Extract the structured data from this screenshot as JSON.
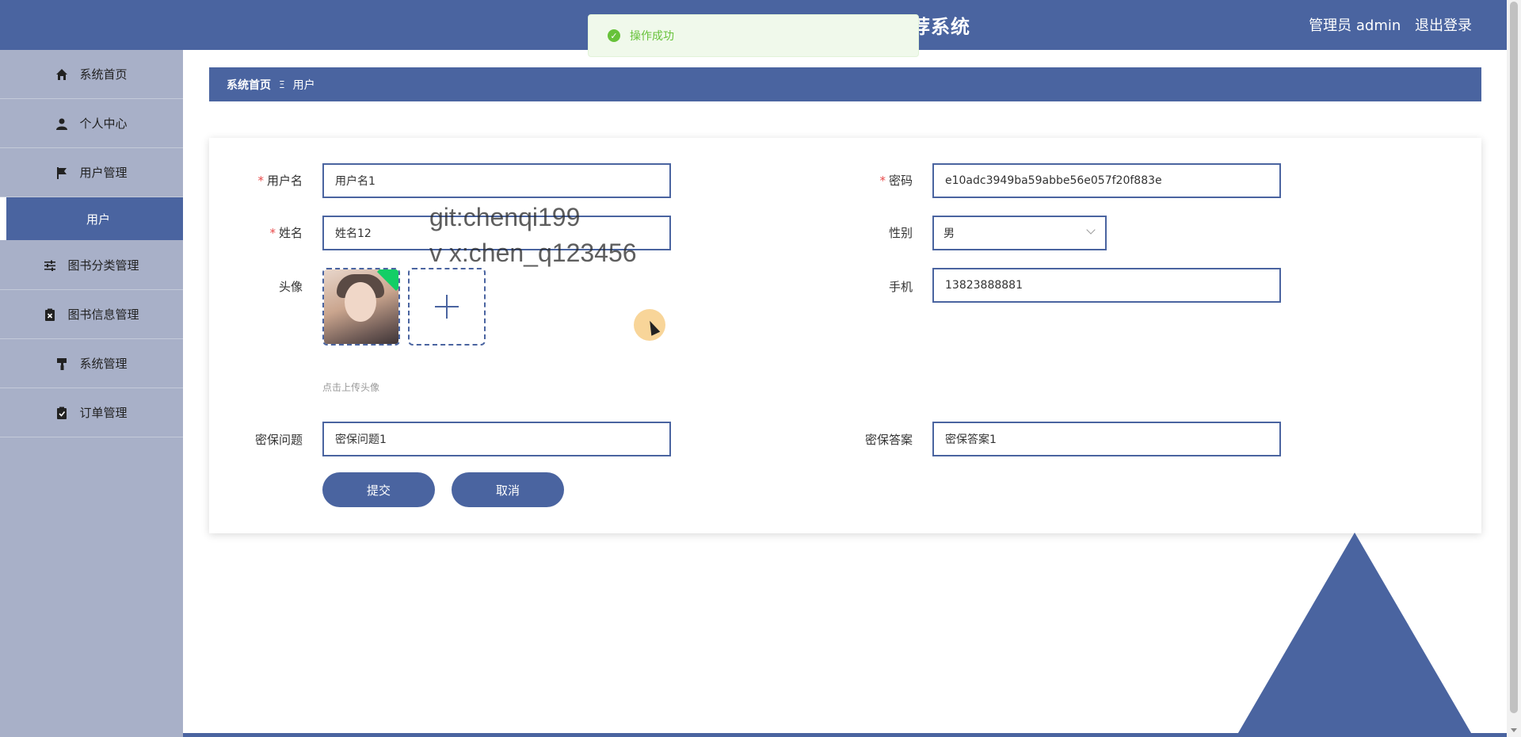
{
  "header": {
    "title": "荐系统",
    "user_label": "管理员 admin",
    "logout_label": "退出登录"
  },
  "toast": {
    "message": "操作成功",
    "icon": "check-circle-icon"
  },
  "sidebar": {
    "items": [
      {
        "label": "系统首页",
        "icon": "home-icon"
      },
      {
        "label": "个人中心",
        "icon": "person-icon"
      },
      {
        "label": "用户管理",
        "icon": "flag-icon"
      },
      {
        "label": "用户",
        "icon": ""
      },
      {
        "label": "图书分类管理",
        "icon": "sliders-icon"
      },
      {
        "label": "图书信息管理",
        "icon": "clipboard-x-icon"
      },
      {
        "label": "系统管理",
        "icon": "paint-roller-icon"
      },
      {
        "label": "订单管理",
        "icon": "clipboard-check-icon"
      }
    ]
  },
  "breadcrumb": {
    "home": "系统首页",
    "separator": "Ξ",
    "current": "用户"
  },
  "form": {
    "username_label": "用户名",
    "username_value": "用户名1",
    "password_label": "密码",
    "password_value": "e10adc3949ba59abbe56e057f20f883e",
    "name_label": "姓名",
    "name_value": "姓名12",
    "gender_label": "性别",
    "gender_value": "男",
    "avatar_label": "头像",
    "phone_label": "手机",
    "phone_value": "13823888881",
    "upload_tip": "点击上传头像",
    "question_label": "密保问题",
    "question_value": "密保问题1",
    "answer_label": "密保答案",
    "answer_value": "密保答案1",
    "submit_label": "提交",
    "cancel_label": "取消"
  },
  "watermark": {
    "line1": "git:chenqi199",
    "line2": "v x:chen_q123456"
  },
  "colors": {
    "primary": "#4a64a0",
    "sidebar_bg": "#a8b0c8",
    "success": "#67c23a",
    "required": "#e84a4a"
  }
}
